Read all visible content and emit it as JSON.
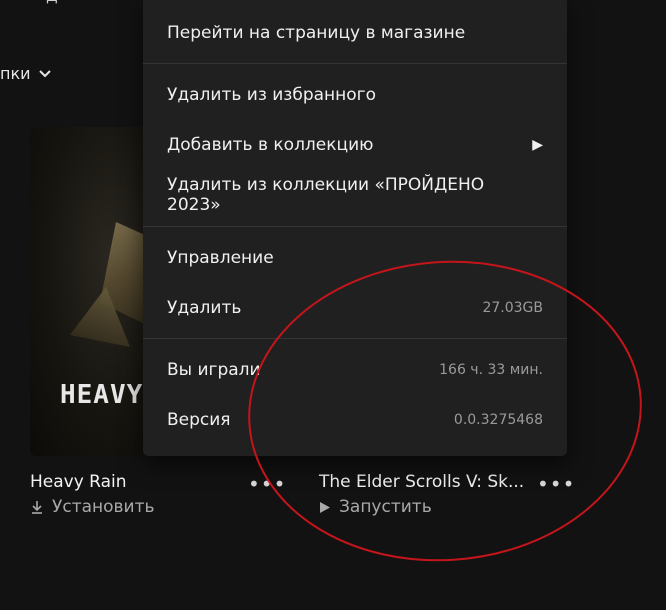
{
  "background_fragment": {
    "top_text": "д",
    "filter_label": "пки"
  },
  "games": [
    {
      "name": "Heavy Rain",
      "cover_title": "HEAVY",
      "action": "Установить"
    },
    {
      "name": "The Elder Scrolls V: Sk...",
      "action": "Запустить"
    }
  ],
  "context_menu": {
    "store_page": "Перейти на страницу в магазине",
    "remove_favorite": "Удалить из избранного",
    "add_collection": "Добавить в коллекцию",
    "remove_collection": "Удалить из коллекции «ПРОЙДЕНО 2023»",
    "manage": "Управление",
    "uninstall": "Удалить",
    "uninstall_size": "27.03GB",
    "played_label": "Вы играли",
    "played_value": "166 ч. 33 мин.",
    "version_label": "Версия",
    "version_value": "0.0.3275468"
  },
  "colors": {
    "background": "#121212",
    "menu": "#202020",
    "annotation_ellipse": "#c4151b"
  }
}
